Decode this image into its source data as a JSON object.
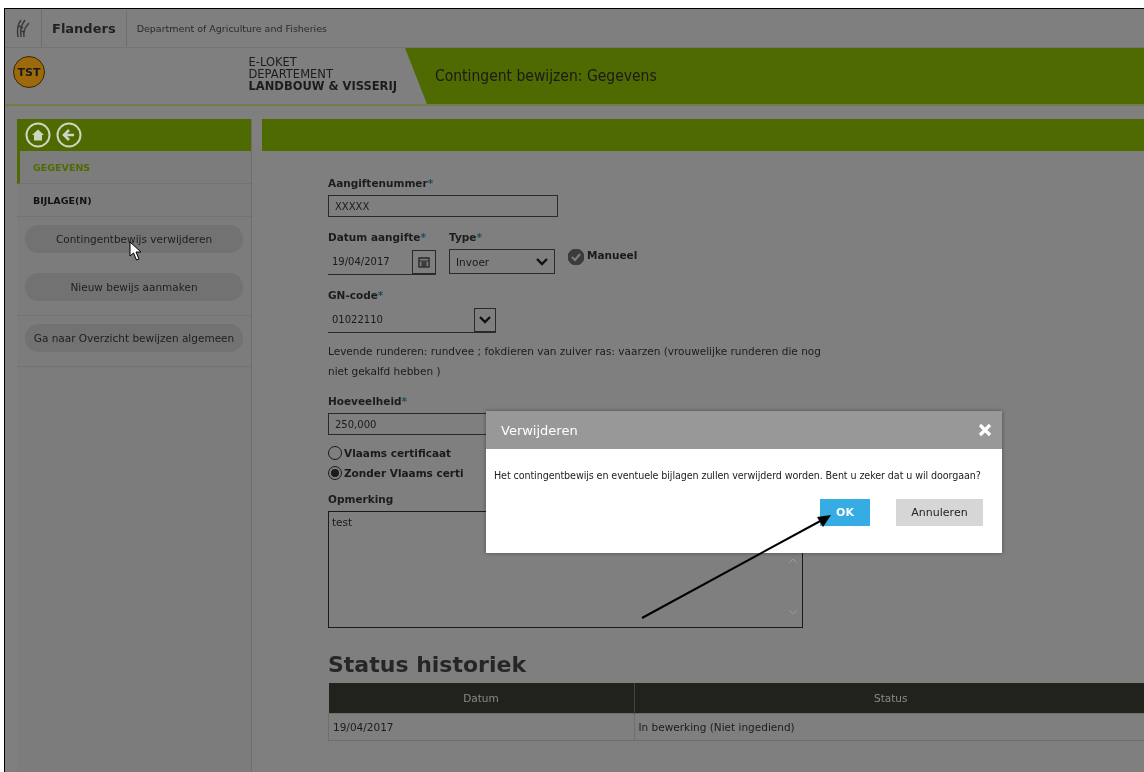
{
  "topbar": {
    "brand": "Flanders",
    "department": "Department of Agriculture and Fisheries"
  },
  "header": {
    "badge": "TST",
    "org_lines": [
      "E-LOKET",
      "DEPARTEMENT",
      "LANDBOUW & VISSERIJ"
    ],
    "page_title": "Contingent bewijzen: Gegevens"
  },
  "sidebar": {
    "tabs": [
      {
        "label": "GEGEVENS",
        "selected": true
      },
      {
        "label": "BIJLAGE(N)",
        "selected": false
      }
    ],
    "buttons": [
      "Contingentbewijs verwijderen",
      "Nieuw bewijs aanmaken"
    ],
    "footer_buttons": [
      "Ga naar Overzicht bewijzen algemeen"
    ]
  },
  "form": {
    "aangiftenummer": {
      "label": "Aangiftenummer",
      "required_mark": "*",
      "value": "XXXXX"
    },
    "datum": {
      "label": "Datum aangifte",
      "required_mark": "*",
      "value": "19/04/2017"
    },
    "type": {
      "label": "Type",
      "required_mark": "*",
      "value": "Invoer"
    },
    "manueel": {
      "label": "Manueel",
      "checked": true
    },
    "gn_code": {
      "label": "GN-code",
      "required_mark": "*",
      "value": "01022110"
    },
    "description": "Levende runderen: rundvee ; fokdieren van zuiver ras: vaarzen (vrouwelijke runderen die nog niet gekalfd hebben )",
    "hoeveelheid": {
      "label": "Hoeveelheid",
      "required_mark": "*",
      "value": "250,000"
    },
    "certificate": [
      {
        "label": "Vlaams certificaat",
        "selected": false
      },
      {
        "label": "Zonder Vlaams certi",
        "selected": true
      }
    ],
    "opmerking": {
      "label": "Opmerking",
      "value": "test"
    }
  },
  "status_history": {
    "title": "Status historiek",
    "columns": [
      "Datum",
      "Status"
    ],
    "rows": [
      [
        "19/04/2017",
        "In bewerking (Niet ingediend)"
      ]
    ]
  },
  "dialog": {
    "title": "Verwijderen",
    "message": "Het contingentbewijs en eventuele bijlagen zullen verwijderd worden. Bent u zeker dat u wil doorgaan?",
    "ok": "OK",
    "cancel": "Annuleren"
  }
}
